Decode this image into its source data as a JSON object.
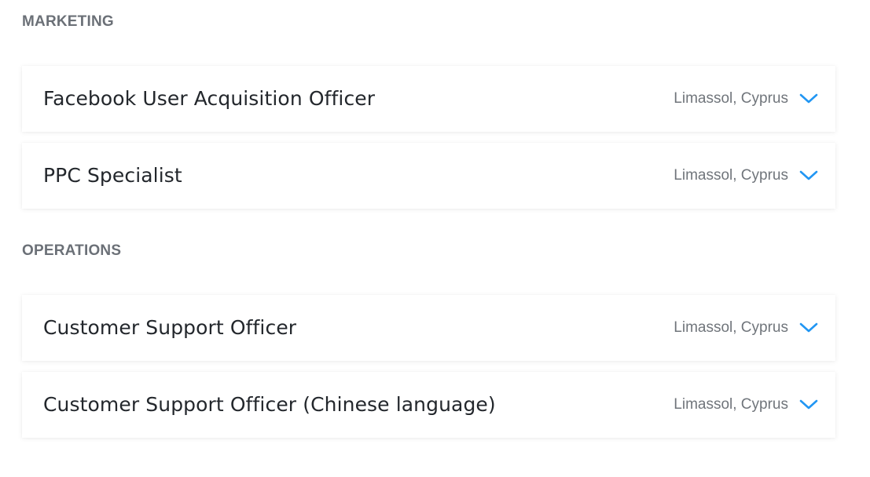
{
  "sections": [
    {
      "title": "MARKETING",
      "jobs": [
        {
          "title": "Facebook User Acquisition Officer",
          "location": "Limassol, Cyprus"
        },
        {
          "title": "PPC Specialist",
          "location": "Limassol, Cyprus"
        }
      ]
    },
    {
      "title": "OPERATIONS",
      "jobs": [
        {
          "title": "Customer Support Officer",
          "location": "Limassol, Cyprus"
        },
        {
          "title": "Customer Support Officer (Chinese language)",
          "location": "Limassol, Cyprus"
        }
      ]
    }
  ],
  "colors": {
    "chevron": "#2196f3",
    "section_title": "#6b7077",
    "job_title": "#23272c",
    "location": "#70757b"
  },
  "icons": {
    "expand": "chevron-down-icon"
  }
}
